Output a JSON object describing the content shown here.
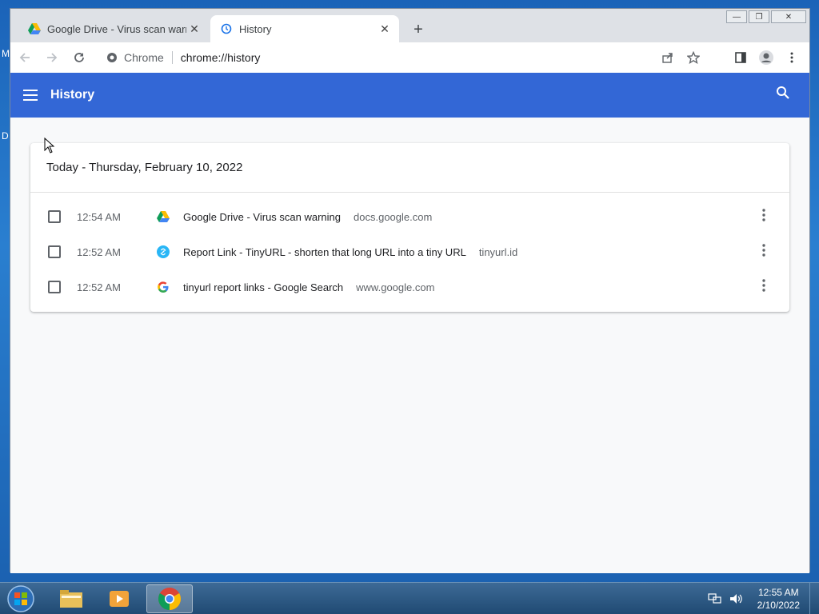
{
  "desktop": {
    "letters": [
      "M",
      "D"
    ]
  },
  "tabs": [
    {
      "title": "Google Drive - Virus scan warning",
      "close": "✕"
    },
    {
      "title": "History",
      "close": "✕"
    }
  ],
  "new_tab": "+",
  "window_controls": {
    "minimize": "—",
    "maximize": "❐",
    "close": "✕"
  },
  "omnibox": {
    "chip": "Chrome",
    "url": "chrome://history"
  },
  "appbar": {
    "title": "History"
  },
  "history": {
    "date_header": "Today - Thursday, February 10, 2022",
    "entries": [
      {
        "time": "12:54 AM",
        "title": "Google Drive - Virus scan warning",
        "domain": "docs.google.com",
        "icon": "google-drive-icon"
      },
      {
        "time": "12:52 AM",
        "title": "Report Link - TinyURL - shorten that long URL into a tiny URL",
        "domain": "tinyurl.id",
        "icon": "link-icon"
      },
      {
        "time": "12:52 AM",
        "title": "tinyurl report links - Google Search",
        "domain": "www.google.com",
        "icon": "google-icon"
      }
    ]
  },
  "taskbar": {
    "time": "12:55 AM",
    "date": "2/10/2022"
  },
  "colors": {
    "accent": "#3367d6",
    "taskbar": "#204a73"
  }
}
